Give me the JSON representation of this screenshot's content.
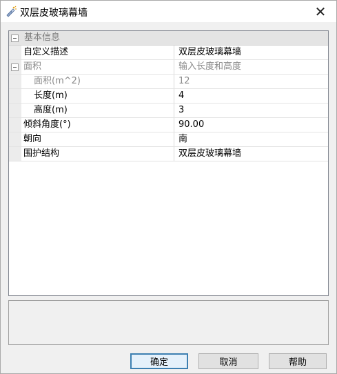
{
  "window": {
    "title": "双层皮玻璃幕墙",
    "close_glyph": "✕"
  },
  "property_grid": {
    "category_label": "基本信息",
    "rows": [
      {
        "name": "自定义描述",
        "value": "双层皮玻璃幕墙"
      },
      {
        "name": "面积",
        "value": "输入长度和高度"
      },
      {
        "name": "面积(m^2)",
        "value": "12"
      },
      {
        "name": "长度(m)",
        "value": "4"
      },
      {
        "name": "高度(m)",
        "value": "3"
      },
      {
        "name": "倾斜角度(°)",
        "value": "90.00"
      },
      {
        "name": "朝向",
        "value": "南"
      },
      {
        "name": "围护结构",
        "value": "双层皮玻璃幕墙"
      }
    ]
  },
  "buttons": {
    "ok": "确定",
    "cancel": "取消",
    "help": "帮助"
  },
  "colors": {
    "default_button_border": "#3c7fb1",
    "category_background": "#e4e4e4",
    "disabled_text": "#8a8a8a"
  }
}
